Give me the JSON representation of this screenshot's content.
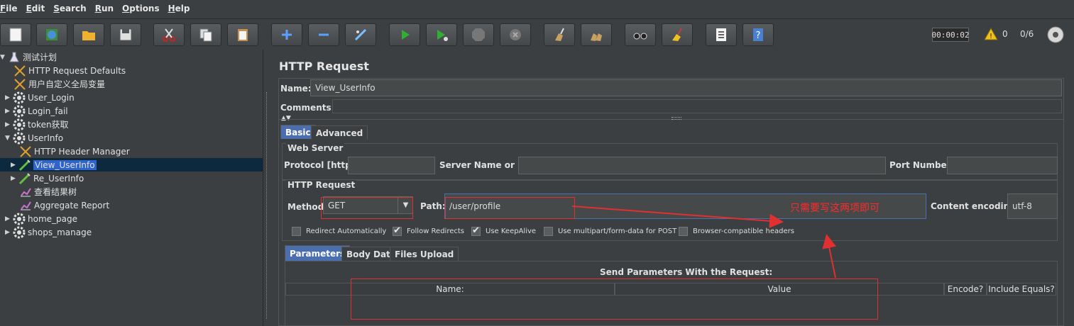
{
  "menu": {
    "items": [
      {
        "label": "File",
        "u": "F"
      },
      {
        "label": "Edit",
        "u": "E"
      },
      {
        "label": "Search",
        "u": "S"
      },
      {
        "label": "Run",
        "u": "R"
      },
      {
        "label": "Options",
        "u": "O"
      },
      {
        "label": "Help",
        "u": "H"
      }
    ]
  },
  "toolbar": {
    "timer": "00:00:02",
    "warning_count": "0",
    "threads": "0/6"
  },
  "tree": {
    "items": [
      {
        "label": "测试计划",
        "arrow": "▼",
        "icon": "flask-icon"
      },
      {
        "label": "HTTP Request Defaults",
        "arrow": "",
        "icon": "wrench-icon"
      },
      {
        "label": "用户自定义全局变量",
        "arrow": "",
        "icon": "wrench-icon"
      },
      {
        "label": "User_Login",
        "arrow": "▶",
        "icon": "gear-icon"
      },
      {
        "label": "Login_fail",
        "arrow": "▶",
        "icon": "gear-icon"
      },
      {
        "label": "token获取",
        "arrow": "▶",
        "icon": "gear-icon"
      },
      {
        "label": "UserInfo",
        "arrow": "▼",
        "icon": "gear-icon"
      },
      {
        "label": "HTTP Header Manager",
        "arrow": "",
        "icon": "wrench-icon"
      },
      {
        "label": "View_UserInfo",
        "arrow": "▶",
        "icon": "pipette-icon"
      },
      {
        "label": "Re_UserInfo",
        "arrow": "▶",
        "icon": "pipette-icon"
      },
      {
        "label": "查看结果树",
        "arrow": "",
        "icon": "chart-icon"
      },
      {
        "label": "Aggregate Report",
        "arrow": "",
        "icon": "chart-icon"
      },
      {
        "label": "home_page",
        "arrow": "▶",
        "icon": "gear-icon"
      },
      {
        "label": "shops_manage",
        "arrow": "▶",
        "icon": "gear-icon"
      }
    ]
  },
  "request": {
    "title": "HTTP Request",
    "name_label": "Name:",
    "name_value": "View_UserInfo",
    "comments_label": "Comments:",
    "tabs": [
      "Basic",
      "Advanced"
    ],
    "web_server": {
      "title": "Web Server",
      "protocol_label": "Protocol [http]:",
      "protocol_value": "",
      "server_label": "Server Name or IP:",
      "server_value": "",
      "port_label": "Port Number:",
      "port_value": ""
    },
    "http_request": {
      "title": "HTTP Request",
      "method_label": "Method:",
      "method_value": "GET",
      "path_label": "Path:",
      "path_value": "/user/profile",
      "encoding_label": "Content encoding:",
      "encoding_value": "utf-8"
    },
    "checkboxes": [
      {
        "label": "Redirect Automatically",
        "checked": false
      },
      {
        "label": "Follow Redirects",
        "checked": true
      },
      {
        "label": "Use KeepAlive",
        "checked": true
      },
      {
        "label": "Use multipart/form-data for POST",
        "checked": false
      },
      {
        "label": "Browser-compatible headers",
        "checked": false
      }
    ],
    "param_tabs": [
      "Parameters",
      "Body Data",
      "Files Upload"
    ],
    "params_title": "Send Parameters With the Request:",
    "columns": [
      "Name:",
      "Value",
      "Encode?",
      "Include Equals?"
    ]
  },
  "annotation": {
    "text": "只需要写这两项即可",
    "color": "#ff2a2a"
  }
}
